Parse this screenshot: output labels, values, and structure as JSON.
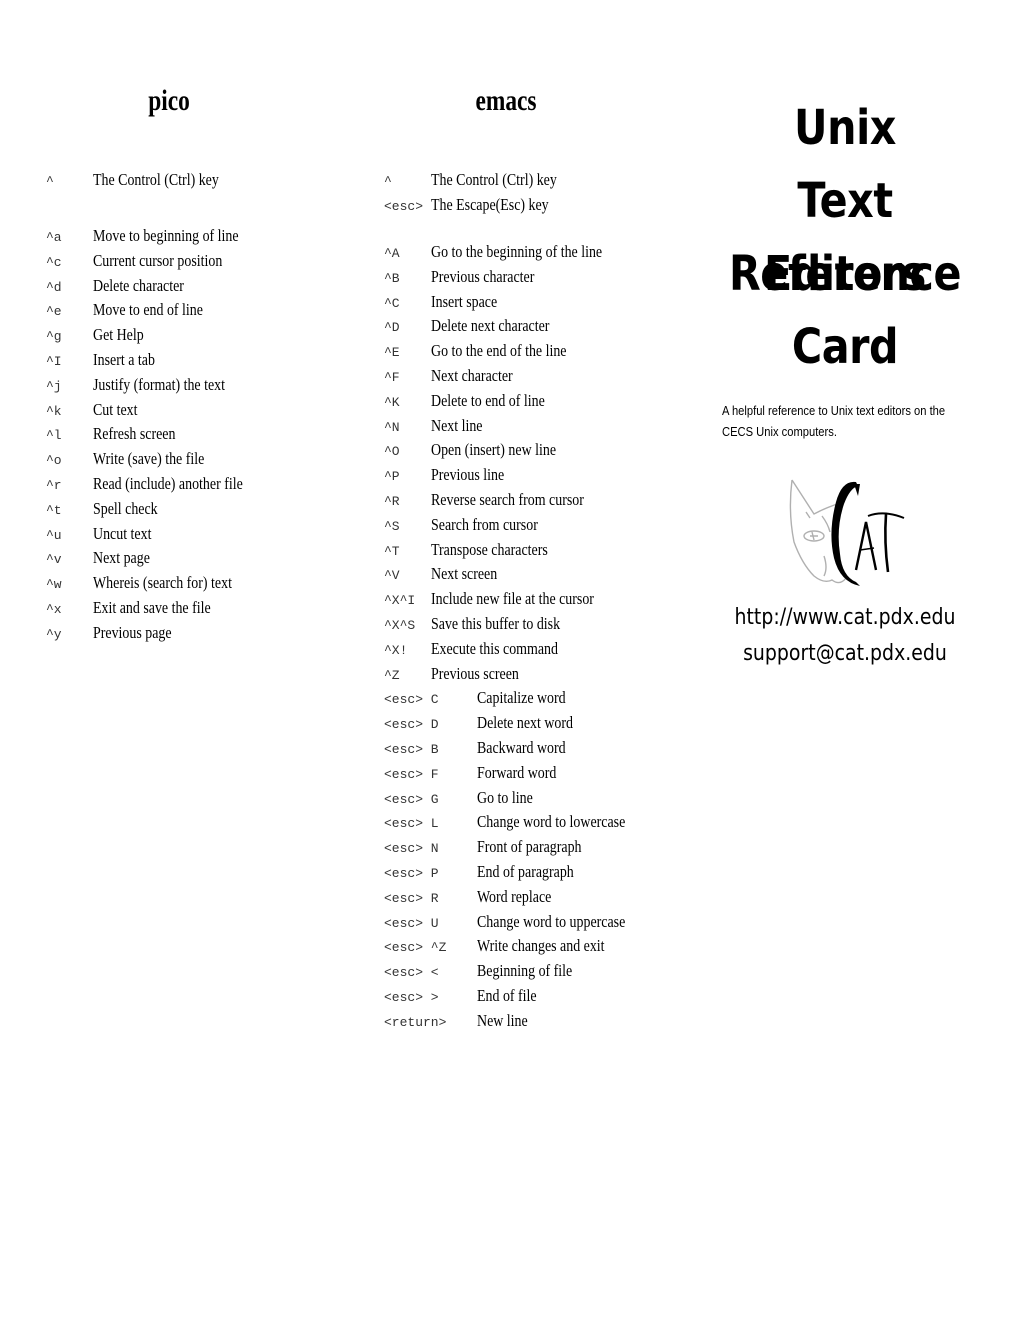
{
  "pico": {
    "title": "pico",
    "legend": [
      {
        "key": "^",
        "desc": "The Control (Ctrl) key"
      }
    ],
    "commands": [
      {
        "key": "^a",
        "desc": "Move to beginning of line"
      },
      {
        "key": "^c",
        "desc": "Current cursor position"
      },
      {
        "key": "^d",
        "desc": "Delete character"
      },
      {
        "key": "^e",
        "desc": "Move to end of line"
      },
      {
        "key": "^g",
        "desc": "Get Help"
      },
      {
        "key": "^I",
        "desc": "Insert a tab"
      },
      {
        "key": "^j",
        "desc": "Justify (format) the text"
      },
      {
        "key": "^k",
        "desc": "Cut text"
      },
      {
        "key": "^l",
        "desc": "Refresh screen"
      },
      {
        "key": "^o",
        "desc": "Write (save) the file"
      },
      {
        "key": "^r",
        "desc": "Read (include) another file"
      },
      {
        "key": "^t",
        "desc": "Spell check"
      },
      {
        "key": "^u",
        "desc": "Uncut text"
      },
      {
        "key": "^v",
        "desc": "Next page"
      },
      {
        "key": "^w",
        "desc": "Whereis (search for) text"
      },
      {
        "key": "^x",
        "desc": "Exit and save the file"
      },
      {
        "key": "^y",
        "desc": "Previous page"
      }
    ]
  },
  "emacs": {
    "title": "emacs",
    "legend": [
      {
        "key": "^",
        "desc": "The Control (Ctrl) key"
      },
      {
        "key": "<esc>",
        "desc": "The Escape(Esc) key"
      }
    ],
    "commands": [
      {
        "key": "^A",
        "desc": "Go to the beginning of the line"
      },
      {
        "key": "^B",
        "desc": "Previous character"
      },
      {
        "key": "^C",
        "desc": "Insert space"
      },
      {
        "key": "^D",
        "desc": "Delete next character"
      },
      {
        "key": "^E",
        "desc": "Go to the end of the line"
      },
      {
        "key": "^F",
        "desc": "Next character"
      },
      {
        "key": "^K",
        "desc": "Delete to end of line"
      },
      {
        "key": "^N",
        "desc": "Next line"
      },
      {
        "key": "^O",
        "desc": "Open (insert) new line"
      },
      {
        "key": "^P",
        "desc": "Previous line"
      },
      {
        "key": "^R",
        "desc": "Reverse search from cursor"
      },
      {
        "key": "^S",
        "desc": "Search from cursor"
      },
      {
        "key": "^T",
        "desc": "Transpose characters"
      },
      {
        "key": "^V",
        "desc": "Next screen"
      },
      {
        "key": "^X^I",
        "desc": "Include new file at the cursor"
      },
      {
        "key": "^X^S",
        "desc": "Save this buffer to disk"
      },
      {
        "key": "^X!",
        "desc": "Execute this command"
      },
      {
        "key": "^Z",
        "desc": "Previous screen"
      }
    ],
    "esc_commands": [
      {
        "key": "<esc> C",
        "desc": "Capitalize word"
      },
      {
        "key": "<esc> D",
        "desc": "Delete next word"
      },
      {
        "key": "<esc> B",
        "desc": "Backward word"
      },
      {
        "key": "<esc> F",
        "desc": "Forward word"
      },
      {
        "key": "<esc> G",
        "desc": "Go to line"
      },
      {
        "key": "<esc> L",
        "desc": "Change word to lowercase"
      },
      {
        "key": "<esc> N",
        "desc": "Front of paragraph"
      },
      {
        "key": "<esc> P",
        "desc": "End of paragraph"
      },
      {
        "key": "<esc>  R",
        "desc": "Word replace"
      },
      {
        "key": "<esc> U",
        "desc": "Change word to uppercase"
      },
      {
        "key": "<esc> ^Z",
        "desc": "Write changes and exit"
      },
      {
        "key": "<esc> <",
        "desc": "Beginning of file"
      },
      {
        "key": "<esc> >",
        "desc": "End of file"
      },
      {
        "key": "<return>",
        "desc": "New line"
      }
    ]
  },
  "cover": {
    "title_lines": [
      "Unix",
      "Text Editors",
      "Reference",
      "Card"
    ],
    "blurb": "A helpful reference to Unix text editors on the CECS Unix computers.",
    "logo": {
      "icon": "cat-logo-icon",
      "text": "CAT"
    },
    "url": "http://www.cat.pdx.edu",
    "email": "support@cat.pdx.edu"
  }
}
